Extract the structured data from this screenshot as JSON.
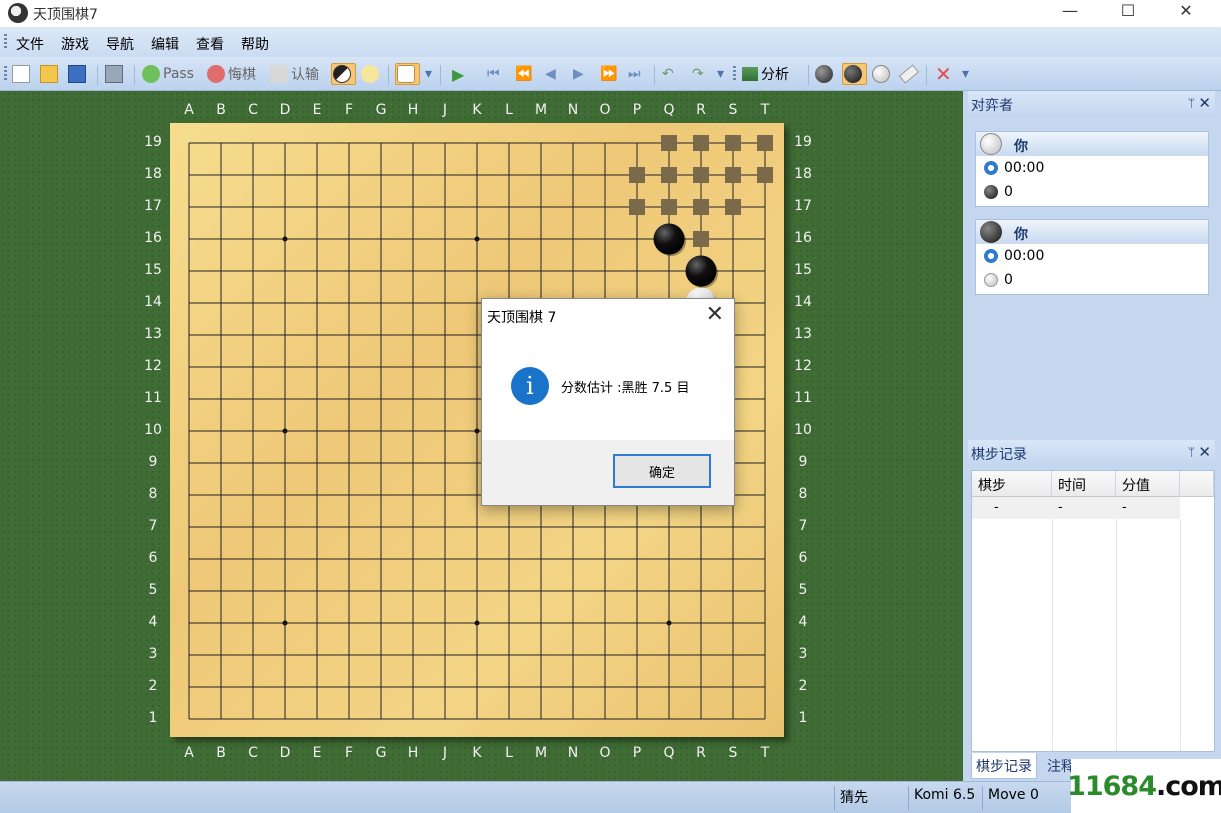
{
  "window": {
    "title": "天顶围棋7",
    "minimize": "—",
    "maximize": "☐",
    "close": "✕"
  },
  "menu": [
    "文件",
    "游戏",
    "导航",
    "编辑",
    "查看",
    "帮助"
  ],
  "toolbar": {
    "pass": "Pass",
    "undo": "悔棋",
    "resign": "认输",
    "analyze": "分析"
  },
  "board": {
    "size": 19,
    "columns": [
      "A",
      "B",
      "C",
      "D",
      "E",
      "F",
      "G",
      "H",
      "J",
      "K",
      "L",
      "M",
      "N",
      "O",
      "P",
      "Q",
      "R",
      "S",
      "T"
    ],
    "rows": [
      "19",
      "18",
      "17",
      "16",
      "15",
      "14",
      "13",
      "12",
      "11",
      "10",
      "9",
      "8",
      "7",
      "6",
      "5",
      "4",
      "3",
      "2",
      "1"
    ],
    "stones": [
      {
        "color": "black",
        "point": "Q16"
      },
      {
        "color": "black",
        "point": "R15"
      },
      {
        "color": "white",
        "point": "R14"
      }
    ],
    "territory_markers": [
      "Q19",
      "R19",
      "S19",
      "T19",
      "P18",
      "Q18",
      "R18",
      "S18",
      "T18",
      "P17",
      "Q17",
      "R17",
      "S17",
      "R16"
    ],
    "star_points": [
      "D16",
      "K16",
      "Q16",
      "D10",
      "K10",
      "Q10",
      "D4",
      "K4",
      "Q4"
    ]
  },
  "dialog": {
    "title": "天顶围棋 7",
    "close": "✕",
    "icon": "i",
    "message": "分数估计 :黑胜 7.5 目",
    "ok": "确定"
  },
  "players_panel": {
    "title": "对弈者",
    "pin": "ᛘ",
    "close": "✕",
    "players": [
      {
        "stone": "white",
        "name": "你",
        "time": "00:00",
        "captures": "0"
      },
      {
        "stone": "black",
        "name": "你",
        "time": "00:00",
        "captures": "0"
      }
    ]
  },
  "moves_panel": {
    "title": "棋步记录",
    "pin": "ᛘ",
    "close": "✕",
    "columns": [
      "棋步",
      "时间",
      "分值"
    ],
    "rows": [
      [
        "-",
        "-",
        "-"
      ]
    ],
    "tabs": [
      "棋步记录",
      "注释"
    ]
  },
  "status": {
    "turn": "猜先",
    "komi": "Komi 6.5",
    "move": "Move 0"
  },
  "watermark": {
    "part1": "11684",
    "part2": ".com"
  },
  "colors": {
    "board_bg": "#3f6b34",
    "board_wood": "#f2d07e",
    "accent": "#1873c9"
  }
}
